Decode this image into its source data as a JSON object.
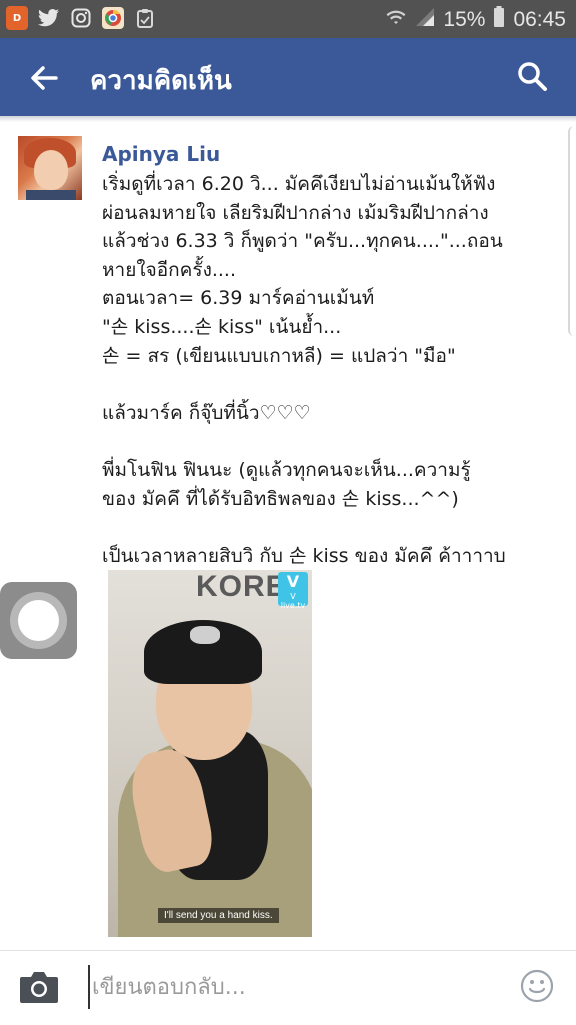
{
  "status_bar": {
    "battery_percent": "15%",
    "time": "06:45",
    "app_badge": "D",
    "icons": [
      "app-badge-icon",
      "twitter-icon",
      "instagram-icon",
      "chrome-icon",
      "clipboard-icon",
      "wifi-icon",
      "signal-icon",
      "battery-icon"
    ]
  },
  "header": {
    "title": "ความคิดเห็น",
    "back_icon": "arrow-left-icon",
    "search_icon": "search-icon",
    "color": "#3b5998"
  },
  "comment": {
    "author": "Apinya Liu",
    "lines": [
      "เริ่มดูที่เวลา 6.20 วิ... มัคคึเงียบไม่อ่านเม้นให้ฟัง",
      "ผ่อนลมหายใจ เลียริมฝีปากล่าง เม้มริมฝีปากล่าง",
      "แล้วช่วง 6.33 วิ ก็พูดว่า \"ครับ...ทุกคน....\"...ถอน",
      "หายใจอีกครั้ง....",
      "ตอนเวลา= 6.39 มาร์คอ่านเม้นท์",
      "\"손 kiss....손 kiss\" เน้นย้ำ...",
      "손 = สร (เขียนแบบเกาหลี) = แปลว่า \"มือ\"",
      "",
      "แล้วมาร์ค ก็จุ๊บที่นิ้ว♡♡♡",
      "",
      "พี่มโนฟิน ฟินนะ (ดูแล้วทุกคนจะเห็น...ความรู้",
      "ของ มัคคึ ที่ได้รับอิทธิพลของ 손 kiss...^^)",
      "",
      "เป็นเวลาหลายสิบวิ กับ 손 kiss ของ มัคคึ ค้าาาาบ"
    ],
    "photo": {
      "sign_text": "KORE",
      "badge_text": "V",
      "badge_sub": "V live.tv",
      "caption": "I'll send you a hand kiss."
    }
  },
  "reply": {
    "placeholder": "เขียนตอบกลับ...",
    "camera_icon": "camera-icon",
    "emoji_icon": "smiley-icon"
  },
  "assistive_touch": {
    "icon": "assistive-touch-icon"
  }
}
